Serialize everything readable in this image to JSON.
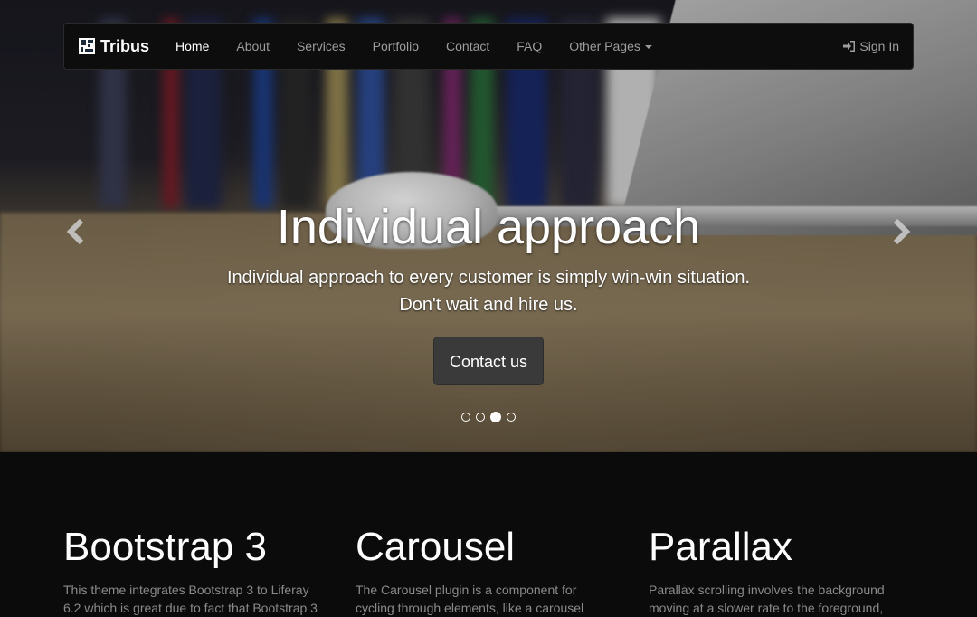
{
  "navbar": {
    "brand": "Tribus",
    "items": [
      {
        "label": "Home",
        "active": true
      },
      {
        "label": "About"
      },
      {
        "label": "Services"
      },
      {
        "label": "Portfolio"
      },
      {
        "label": "Contact"
      },
      {
        "label": "FAQ"
      },
      {
        "label": "Other Pages",
        "dropdown": true
      }
    ],
    "signin": "Sign In",
    "signin_icon": "sign-in-icon"
  },
  "carousel": {
    "title": "Individual approach",
    "subtitle_line1": "Individual approach to every customer is simply win-win situation.",
    "subtitle_line2": "Don't wait and hire us.",
    "button": "Contact us",
    "slide_count": 4,
    "active_slide": 3
  },
  "features": [
    {
      "title": "Bootstrap 3",
      "text_line1": "This theme integrates Bootstrap 3 to Liferay",
      "text_line2": "6.2 which is great due to fact that Bootstrap 3"
    },
    {
      "title": "Carousel",
      "text_line1": "The Carousel plugin is a component for",
      "text_line2": "cycling through elements, like a carousel"
    },
    {
      "title": "Parallax",
      "text_line1": "Parallax scrolling involves the background",
      "text_line2": "moving at a slower rate to the foreground,"
    }
  ],
  "colors": {
    "navbar_bg": "#0d0d0d",
    "nav_text": "#9d9d9d",
    "button_bg": "#3a3a3a",
    "page_bg": "#0b0b0b"
  }
}
